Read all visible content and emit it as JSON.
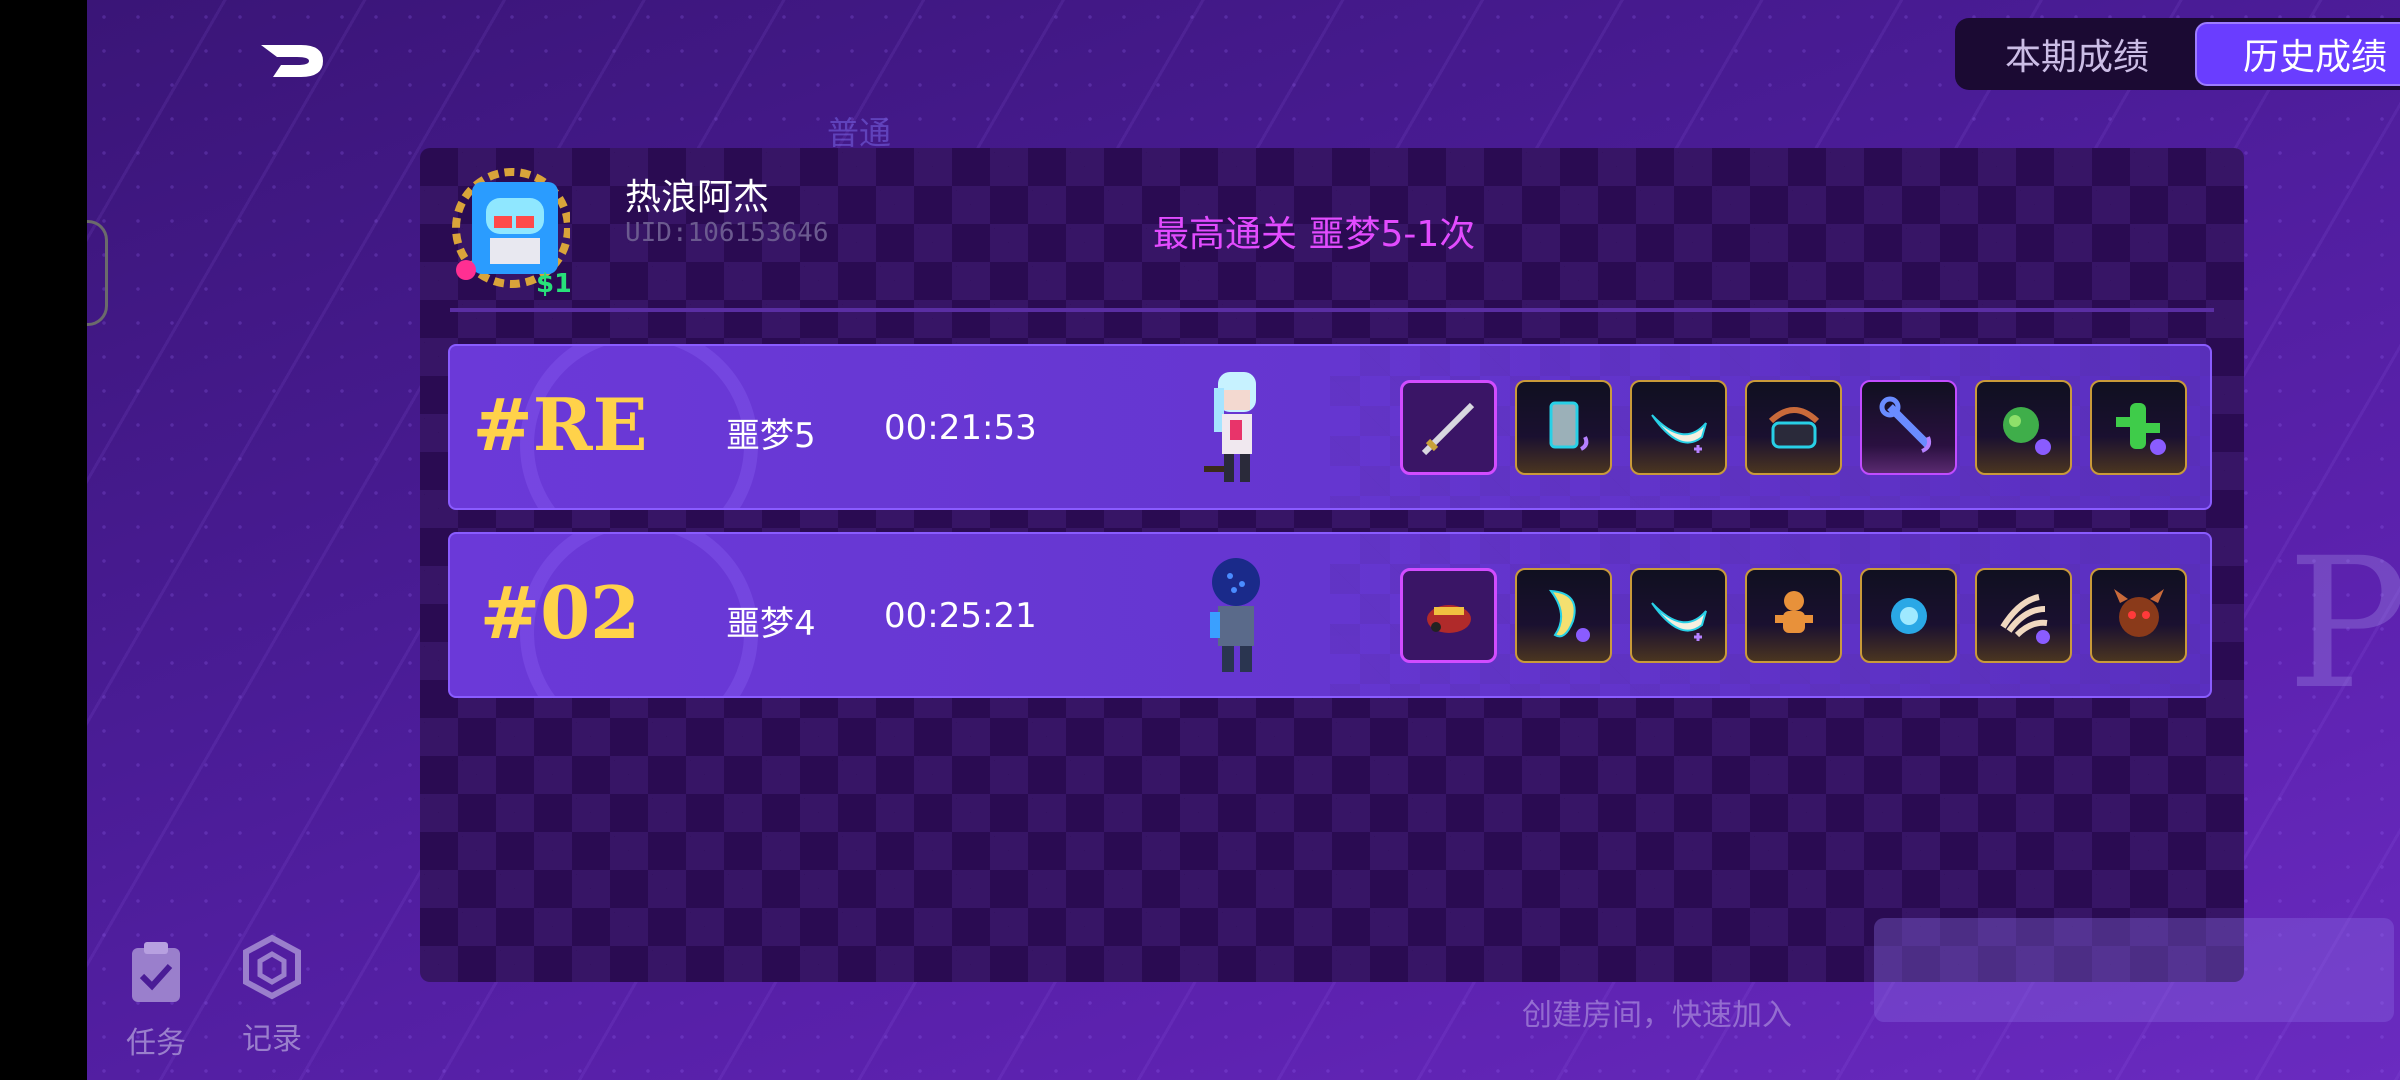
{
  "header": {
    "tabs": [
      {
        "label": "本期成绩",
        "active": false
      },
      {
        "label": "历史成绩",
        "active": true
      }
    ]
  },
  "background": {
    "faded_label": "普通",
    "bottom_links": "创建房间，快速加入"
  },
  "player": {
    "name": "热浪阿杰",
    "uid": "UID:106153646",
    "best_clear": "最高通关 噩梦5-1次"
  },
  "records": [
    {
      "rank": "#RE",
      "difficulty": "噩梦5",
      "time": "00:21:53",
      "hero": "white-haired-girl",
      "items": [
        "sword-icon",
        "card-icon",
        "horn-icon",
        "telephone-icon",
        "wrench-icon",
        "plant-icon",
        "cactus-icon"
      ]
    },
    {
      "rank": "#02",
      "difficulty": "噩梦4",
      "time": "00:25:21",
      "hero": "blue-helmet-knight",
      "items": [
        "red-crab-gun-icon",
        "tooth-icon",
        "horn-icon",
        "gingerbread-icon",
        "blue-ring-icon",
        "claw-icon",
        "demon-mask-icon"
      ]
    }
  ],
  "nav": [
    {
      "label": "任务",
      "icon": "clipboard-icon"
    },
    {
      "label": "记录",
      "icon": "hexagon-icon"
    }
  ],
  "colors": {
    "accent": "#6a3dff",
    "rank_gold": "#ffd24a",
    "best_clear": "#e24bff"
  }
}
